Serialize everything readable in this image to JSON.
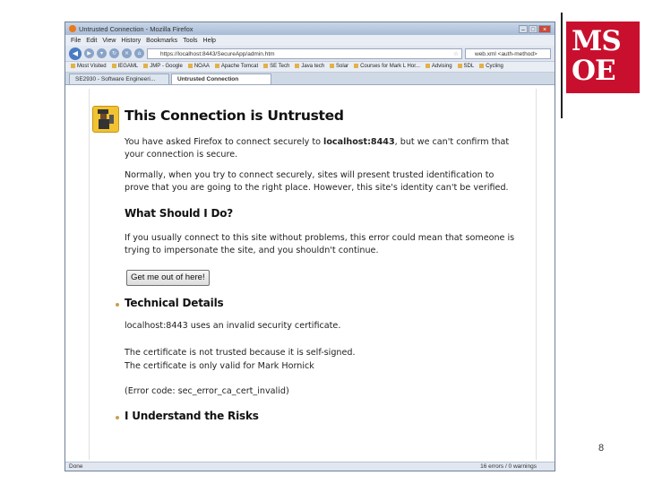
{
  "browser": {
    "title": "Untrusted Connection - Mozilla Firefox",
    "menu": [
      "File",
      "Edit",
      "View",
      "History",
      "Bookmarks",
      "Tools",
      "Help"
    ],
    "url": "https://localhost:8443/SecureApp/admin.htm",
    "search": "web.xml <auth-method>",
    "bookmarks": [
      "Most Visited",
      "IEGAML",
      "JMP - Google",
      "NOAA",
      "Apache Tomcat",
      "SE Tech",
      "Java tech",
      "Solar",
      "Courses for Mark L Hor...",
      "Advising",
      "SDL",
      "Cycling"
    ],
    "tabs": [
      {
        "label": "SE2930 - Software Engineeri...",
        "active": false
      },
      {
        "label": "Untrusted Connection",
        "active": true
      }
    ],
    "status_left": "Done",
    "status_right": "16 errors / 0 warnings"
  },
  "page": {
    "title": "This Connection is Untrusted",
    "p1_pre": "You have asked Firefox to connect securely to ",
    "p1_host": "localhost:8443",
    "p1_post": ", but we can't confirm that your connection is secure.",
    "p2": "Normally, when you try to connect securely, sites will present trusted identification to prove that you are going to the right place. However, this site's identity can't be verified.",
    "what_heading": "What Should I Do?",
    "p3": "If you usually connect to this site without problems, this error could mean that someone is trying to impersonate the site, and you shouldn't continue.",
    "get_out_button": "Get me out of here!",
    "technical_heading": "Technical Details",
    "tech1": "localhost:8443 uses an invalid security certificate.",
    "tech2": "The certificate is not trusted because it is self-signed.",
    "tech3": "The certificate is only valid for Mark Hornick",
    "tech4": "(Error code: sec_error_ca_cert_invalid)",
    "risks_heading": "I Understand the Risks"
  },
  "slide": {
    "logo_line1": "MS",
    "logo_line2": "OE",
    "logo_color": "#c8102e",
    "page_number": "8"
  }
}
